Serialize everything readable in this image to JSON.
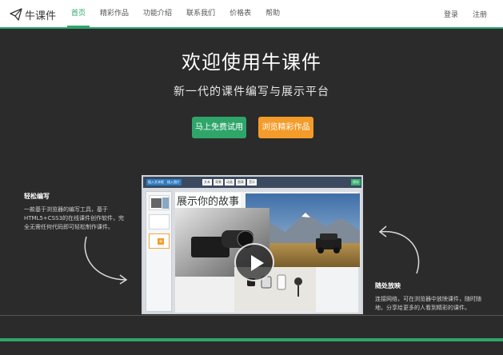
{
  "brand": {
    "name": "牛课件",
    "icon": "paper-plane-icon"
  },
  "nav": {
    "items": [
      {
        "label": "首页",
        "active": true
      },
      {
        "label": "精彩作品",
        "active": false
      },
      {
        "label": "功能介绍",
        "active": false
      },
      {
        "label": "联系我们",
        "active": false
      },
      {
        "label": "价格表",
        "active": false
      },
      {
        "label": "帮助",
        "active": false
      }
    ]
  },
  "auth": {
    "login": "登录",
    "register": "注册"
  },
  "hero": {
    "title": "欢迎使用牛课件",
    "subtitle": "新一代的课件编写与展示平台",
    "primary_button": "马上免费试用",
    "secondary_button": "浏览精彩作品"
  },
  "features": {
    "left": {
      "title": "轻松编写",
      "text": "一款基于浏览器的编写工具，基于HTML5+CSS3的在线课件创作软件，完全无需任何代码即可轻松制作课件。"
    },
    "right": {
      "title": "随处放映",
      "text": "连接网络，可在浏览器中放映课件，随时随地，分享给更多的人看到精彩的课件。"
    }
  },
  "mock": {
    "toolbar_left": [
      "插入文本框",
      "插入图片"
    ],
    "toolbar_mid": [
      "文本",
      "背景",
      "动画",
      "图表",
      "音乐"
    ],
    "toolbar_right": "保存",
    "slide_title": "展示你的故事"
  },
  "colors": {
    "accent": "#2fa56a",
    "orange": "#f39c2a",
    "background": "#2b2b2b"
  }
}
